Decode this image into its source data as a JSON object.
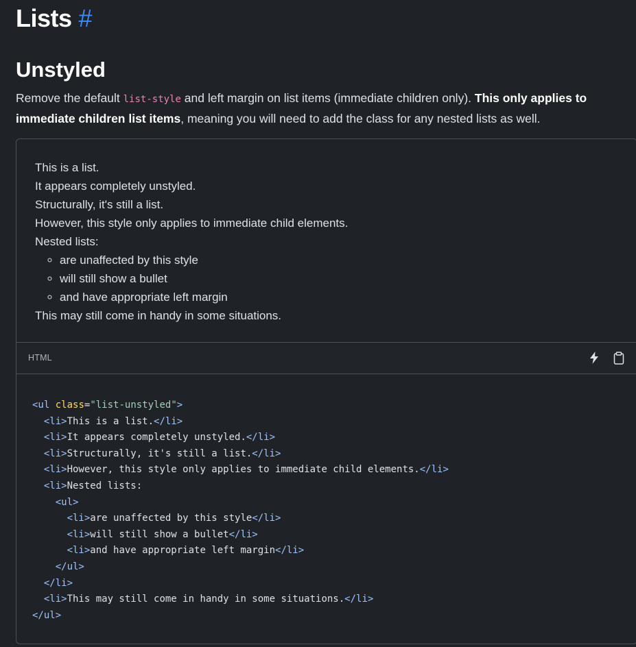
{
  "heading": {
    "title": "Lists",
    "anchor": "#"
  },
  "section": {
    "title": "Unstyled",
    "desc_part1": "Remove the default ",
    "desc_code": "list-style",
    "desc_part2": " and left margin on list items (immediate children only). ",
    "desc_bold": "This only applies to immediate children list items",
    "desc_part3": ", meaning you will need to add the class for any nested lists as well."
  },
  "preview": {
    "items": [
      "This is a list.",
      "It appears completely unstyled.",
      "Structurally, it's still a list.",
      "However, this style only applies to immediate child elements.",
      "Nested lists:"
    ],
    "nested": [
      "are unaffected by this style",
      "will still show a bullet",
      "and have appropriate left margin"
    ],
    "last_item": "This may still come in handy in some situations."
  },
  "code_header": {
    "language": "HTML",
    "run_icon": "lightning-icon",
    "copy_icon": "clipboard-icon"
  },
  "code": {
    "open_ul": "<ul",
    "attr_name": "class",
    "attr_eq": "=",
    "attr_val": "\"list-unstyled\"",
    "gt": ">",
    "lines": [
      "This is a list.",
      "It appears completely unstyled.",
      "Structurally, it's still a list.",
      "However, this style only applies to immediate child elements.",
      "Nested lists:"
    ],
    "nested_lines": [
      "are unaffected by this style",
      "will still show a bullet",
      "and have appropriate left margin"
    ],
    "last_line": "This may still come in handy in some situations.",
    "li_open": "<li>",
    "li_close": "</li>",
    "ul_open": "<ul>",
    "ul_close": "</ul>"
  },
  "colors": {
    "background": "#1f2226",
    "anchor": "#3d8bfd",
    "code_inline": "#e685b5",
    "tag": "#9ec5fe",
    "attr": "#ffda6a",
    "string": "#a3cfbb"
  }
}
